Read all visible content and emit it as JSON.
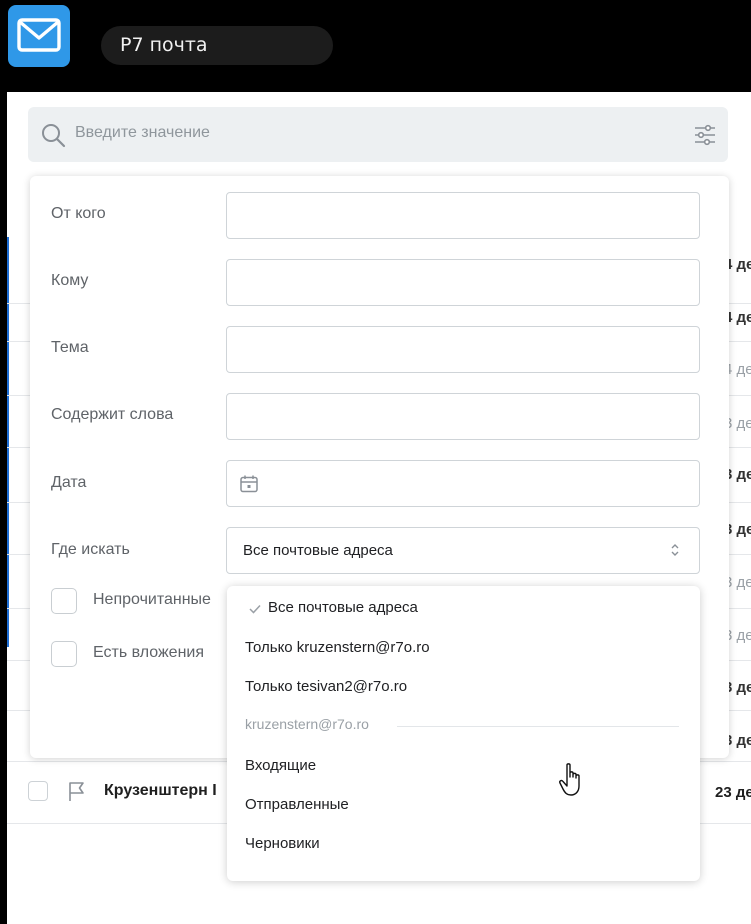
{
  "app": {
    "icon": "mail-icon",
    "title": "Р7 почта"
  },
  "search": {
    "placeholder": "Введите значение",
    "search_icon": "search-icon",
    "filters_icon": "filter-sliders-icon"
  },
  "filters": {
    "from_label": "От кого",
    "to_label": "Кому",
    "subject_label": "Тема",
    "contains_label": "Содержит слова",
    "date_label": "Дата",
    "where_label": "Где искать",
    "where_value": "Все почтовые адреса",
    "unread_label": "Непрочитанные",
    "attachments_label": "Есть вложения"
  },
  "dropdown": {
    "options": [
      "Все почтовые адреса",
      "Только kruzenstern@r7o.ro",
      "Только tesivan2@r7o.ro"
    ],
    "group_label": "kruzenstern@r7o.ro",
    "folders": [
      "Входящие",
      "Отправленные",
      "Черновики"
    ]
  },
  "list": {
    "peek_dates": [
      "4 де",
      "4 де",
      "4 де",
      "3 де",
      "3 де",
      "3 де",
      "3 де",
      "3 де",
      "3 де",
      "3 де"
    ],
    "last_row": {
      "sender": "Крузенштерн I",
      "date": "23 де"
    }
  },
  "colors": {
    "accent": "#2f98e8",
    "topbar": "#000000"
  }
}
